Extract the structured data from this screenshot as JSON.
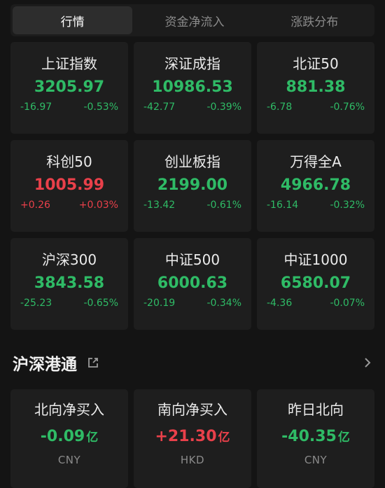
{
  "tabs": [
    {
      "label": "行情",
      "active": true
    },
    {
      "label": "资金净流入",
      "active": false
    },
    {
      "label": "涨跌分布",
      "active": false
    }
  ],
  "indices": [
    {
      "name": "上证指数",
      "value": "3205.97",
      "change": "-16.97",
      "pct": "-0.53%",
      "trend": "down"
    },
    {
      "name": "深证成指",
      "value": "10986.53",
      "change": "-42.77",
      "pct": "-0.39%",
      "trend": "down"
    },
    {
      "name": "北证50",
      "value": "881.38",
      "change": "-6.78",
      "pct": "-0.76%",
      "trend": "down"
    },
    {
      "name": "科创50",
      "value": "1005.99",
      "change": "+0.26",
      "pct": "+0.03%",
      "trend": "up"
    },
    {
      "name": "创业板指",
      "value": "2199.00",
      "change": "-13.42",
      "pct": "-0.61%",
      "trend": "down"
    },
    {
      "name": "万得全A",
      "value": "4966.78",
      "change": "-16.14",
      "pct": "-0.32%",
      "trend": "down"
    },
    {
      "name": "沪深300",
      "value": "3843.58",
      "change": "-25.23",
      "pct": "-0.65%",
      "trend": "down"
    },
    {
      "name": "中证500",
      "value": "6000.63",
      "change": "-20.19",
      "pct": "-0.34%",
      "trend": "down"
    },
    {
      "name": "中证1000",
      "value": "6580.07",
      "change": "-4.36",
      "pct": "-0.07%",
      "trend": "down"
    }
  ],
  "section": {
    "title": "沪深港通",
    "share_icon": "external-link-icon",
    "chevron_icon": "chevron-right-icon"
  },
  "flows": [
    {
      "name": "北向净买入",
      "amount": "-0.09",
      "unit": "亿",
      "currency": "CNY",
      "trend": "down"
    },
    {
      "name": "南向净买入",
      "amount": "+21.30",
      "unit": "亿",
      "currency": "HKD",
      "trend": "up"
    },
    {
      "name": "昨日北向",
      "amount": "-40.35",
      "unit": "亿",
      "currency": "CNY",
      "trend": "down"
    }
  ],
  "colors": {
    "down": "#2fbb66",
    "up": "#e9404a",
    "background": "#141414",
    "card": "#1e1e1e"
  }
}
